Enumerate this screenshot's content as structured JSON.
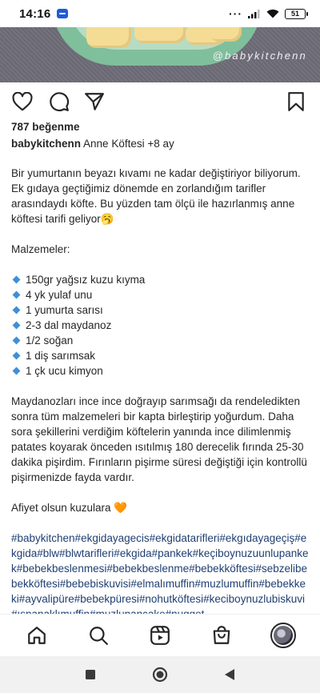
{
  "status_bar": {
    "time": "14:16",
    "dots": "···",
    "battery": "51"
  },
  "post": {
    "watermark": "@babykitchenn",
    "likes": "787 beğenme",
    "username": "babykitchenn",
    "title": " Anne Köftesi +8 ay",
    "intro": "Bir yumurtanın beyazı kıvamı ne kadar değiştiriyor biliyorum. Ek gıdaya geçtiğimiz dönemde en zorlandığım tarifler arasındaydı köfte. Bu yüzden tam ölçü ile hazırlanmış anne köftesi tarifi geliyor🥱",
    "ingredients_title": "Malzemeler:",
    "ingredients": [
      "150gr yağsız kuzu kıyma",
      "4 yk yulaf unu",
      "1 yumurta sarısı",
      "2-3 dal maydanoz",
      "1/2 soğan",
      "1 diş sarımsak",
      "1 çk ucu kimyon"
    ],
    "method": "Maydanozları ince ince doğrayıp sarımsağı da rendeledikten sonra tüm malzemeleri bir kapta birleştirip yoğurdum. Daha sora şekillerini verdiğim köftelerin yanında ince dilimlenmiş patates koyarak önceden ısıtılmış 180 derecelik fırında 25-30 dakika pişirdim. Fırınların pişirme süresi değiştiği için kontrollü pişirmenizde fayda vardır.",
    "closing": "Afiyet olsun kuzulara 🧡",
    "hashtags": "#babykitchen#ekgidayagecis#ekgidatarifleri#ekgıdayageçiş#ekgida#blw#blwtarifleri#ekgida#pankek#keçiboynuzuunlupankek#bebekbeslenmesi#bebekbeslenme#bebekköftesi#sebzelibebekköftesi#bebebiskuvisi#elmalımuffin#muzlumuffin#bebekkeki#ayvalipüre#bebekpüresi#nohutköftesi#keciboynuzlubiskuvi#ıspanaklımuffin#muzlupancake#nugget"
  },
  "icons": {
    "like": "heart-icon",
    "comment": "comment-icon",
    "share": "send-icon",
    "save": "bookmark-icon",
    "home": "home-icon",
    "search": "search-icon",
    "reels": "reels-icon",
    "shop": "shopping-bag-icon",
    "profile": "avatar",
    "sys_recent": "square-icon",
    "sys_home": "circle-icon",
    "sys_back": "triangle-back-icon"
  },
  "colors": {
    "hashtag": "#1f3f72",
    "bullet": "#3f8fd8",
    "text": "#262626"
  }
}
